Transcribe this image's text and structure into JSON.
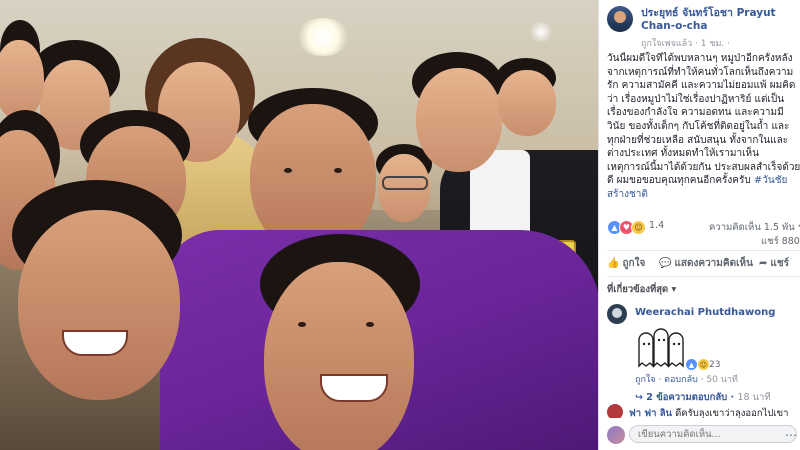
{
  "post": {
    "page_name": "ประยุทธ์ จันทร์โอชา Prayut Chan-o-cha",
    "meta_text": "ถูกใจเพจแล้ว · 1 ชม. ·",
    "body": "วันนี้ผมดีใจที่ได้พบหลานๆ หมูป่าอีกครั้งหลังจากเหตุการณ์ที่ทำให้คนทั่วโลกเห็นถึงความรัก ความสามัคคี และความไม่ยอมแพ้ ผมคิดว่า เรื่องหมูป่าไม่ใช่เรื่องปาฏิหาริย์ แต่เป็นเรื่องของกำลังใจ ความอดทน และความมีวินัย ของทั้งเด็กๆ กับโค้ชที่ติดอยู่ในถ้ำ และทุกฝ่ายที่ช่วยเหลือ สนับสนุน ทั้งจากในและต่างประเทศ ทั้งหมดทำให้เรามาเห็นเหตุการณ์นี้มาได้ด้วยกัน ประสบผลสำเร็จด้วยดี ผมขอขอบคุณทุกคนอีกครั้งครับ",
    "hashtag": "#วันชัยสร้างชาติ"
  },
  "reactions": {
    "count": "1.4",
    "comments": "ความคิดเห็น 1.5 พัน รายการ",
    "shares": "แชร์ 880 ครั้ง"
  },
  "actions": {
    "like": "ถูกใจ",
    "comment": "แสดงความคิดเห็น",
    "share": "แชร์"
  },
  "sort_label": "ที่เกี่ยวข้องที่สุด ▾",
  "comment": {
    "author": "Weerachai Phutdhawong",
    "reaction_count": "23",
    "like": "ถูกใจ",
    "reply": "ตอบกลับ",
    "time": "50 นาที",
    "replies": "2 ข้อความตอบกลับ",
    "replies_time": "18 นาที"
  },
  "comment2": {
    "author": "ฟา ฟา ลิน",
    "text": "ดีครับลุงเขาว่าลุงออกไปเขา"
  },
  "composer": {
    "placeholder": "เขียนความคิดเห็น..."
  },
  "badge_number": "038",
  "colors": {
    "link": "#365899",
    "suit": "#6a2598"
  }
}
